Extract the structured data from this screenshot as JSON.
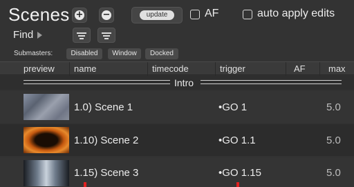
{
  "header": {
    "title": "Scenes",
    "add_symbol": "+",
    "remove_symbol": "−",
    "update_label": "update",
    "af_label": "AF",
    "auto_apply_label": "auto apply edits"
  },
  "find": {
    "label": "Find"
  },
  "submasters": {
    "label": "Submasters:",
    "options": [
      "Disabled",
      "Window",
      "Docked"
    ]
  },
  "columns": [
    "preview",
    "name",
    "timecode",
    "trigger",
    "AF",
    "max"
  ],
  "group": {
    "label": "Intro"
  },
  "scenes": [
    {
      "name": "1.0) Scene 1",
      "trigger": "•GO 1",
      "max": "5.0"
    },
    {
      "name": "1.10) Scene 2",
      "trigger": "•GO 1.1",
      "max": "5.0"
    },
    {
      "name": "1.15) Scene 3",
      "trigger": "•GO 1.15",
      "max": "5.0"
    }
  ],
  "colors": {
    "panel": "#333333",
    "row_alt": "#2c2c2c",
    "marker": "#e02020"
  }
}
